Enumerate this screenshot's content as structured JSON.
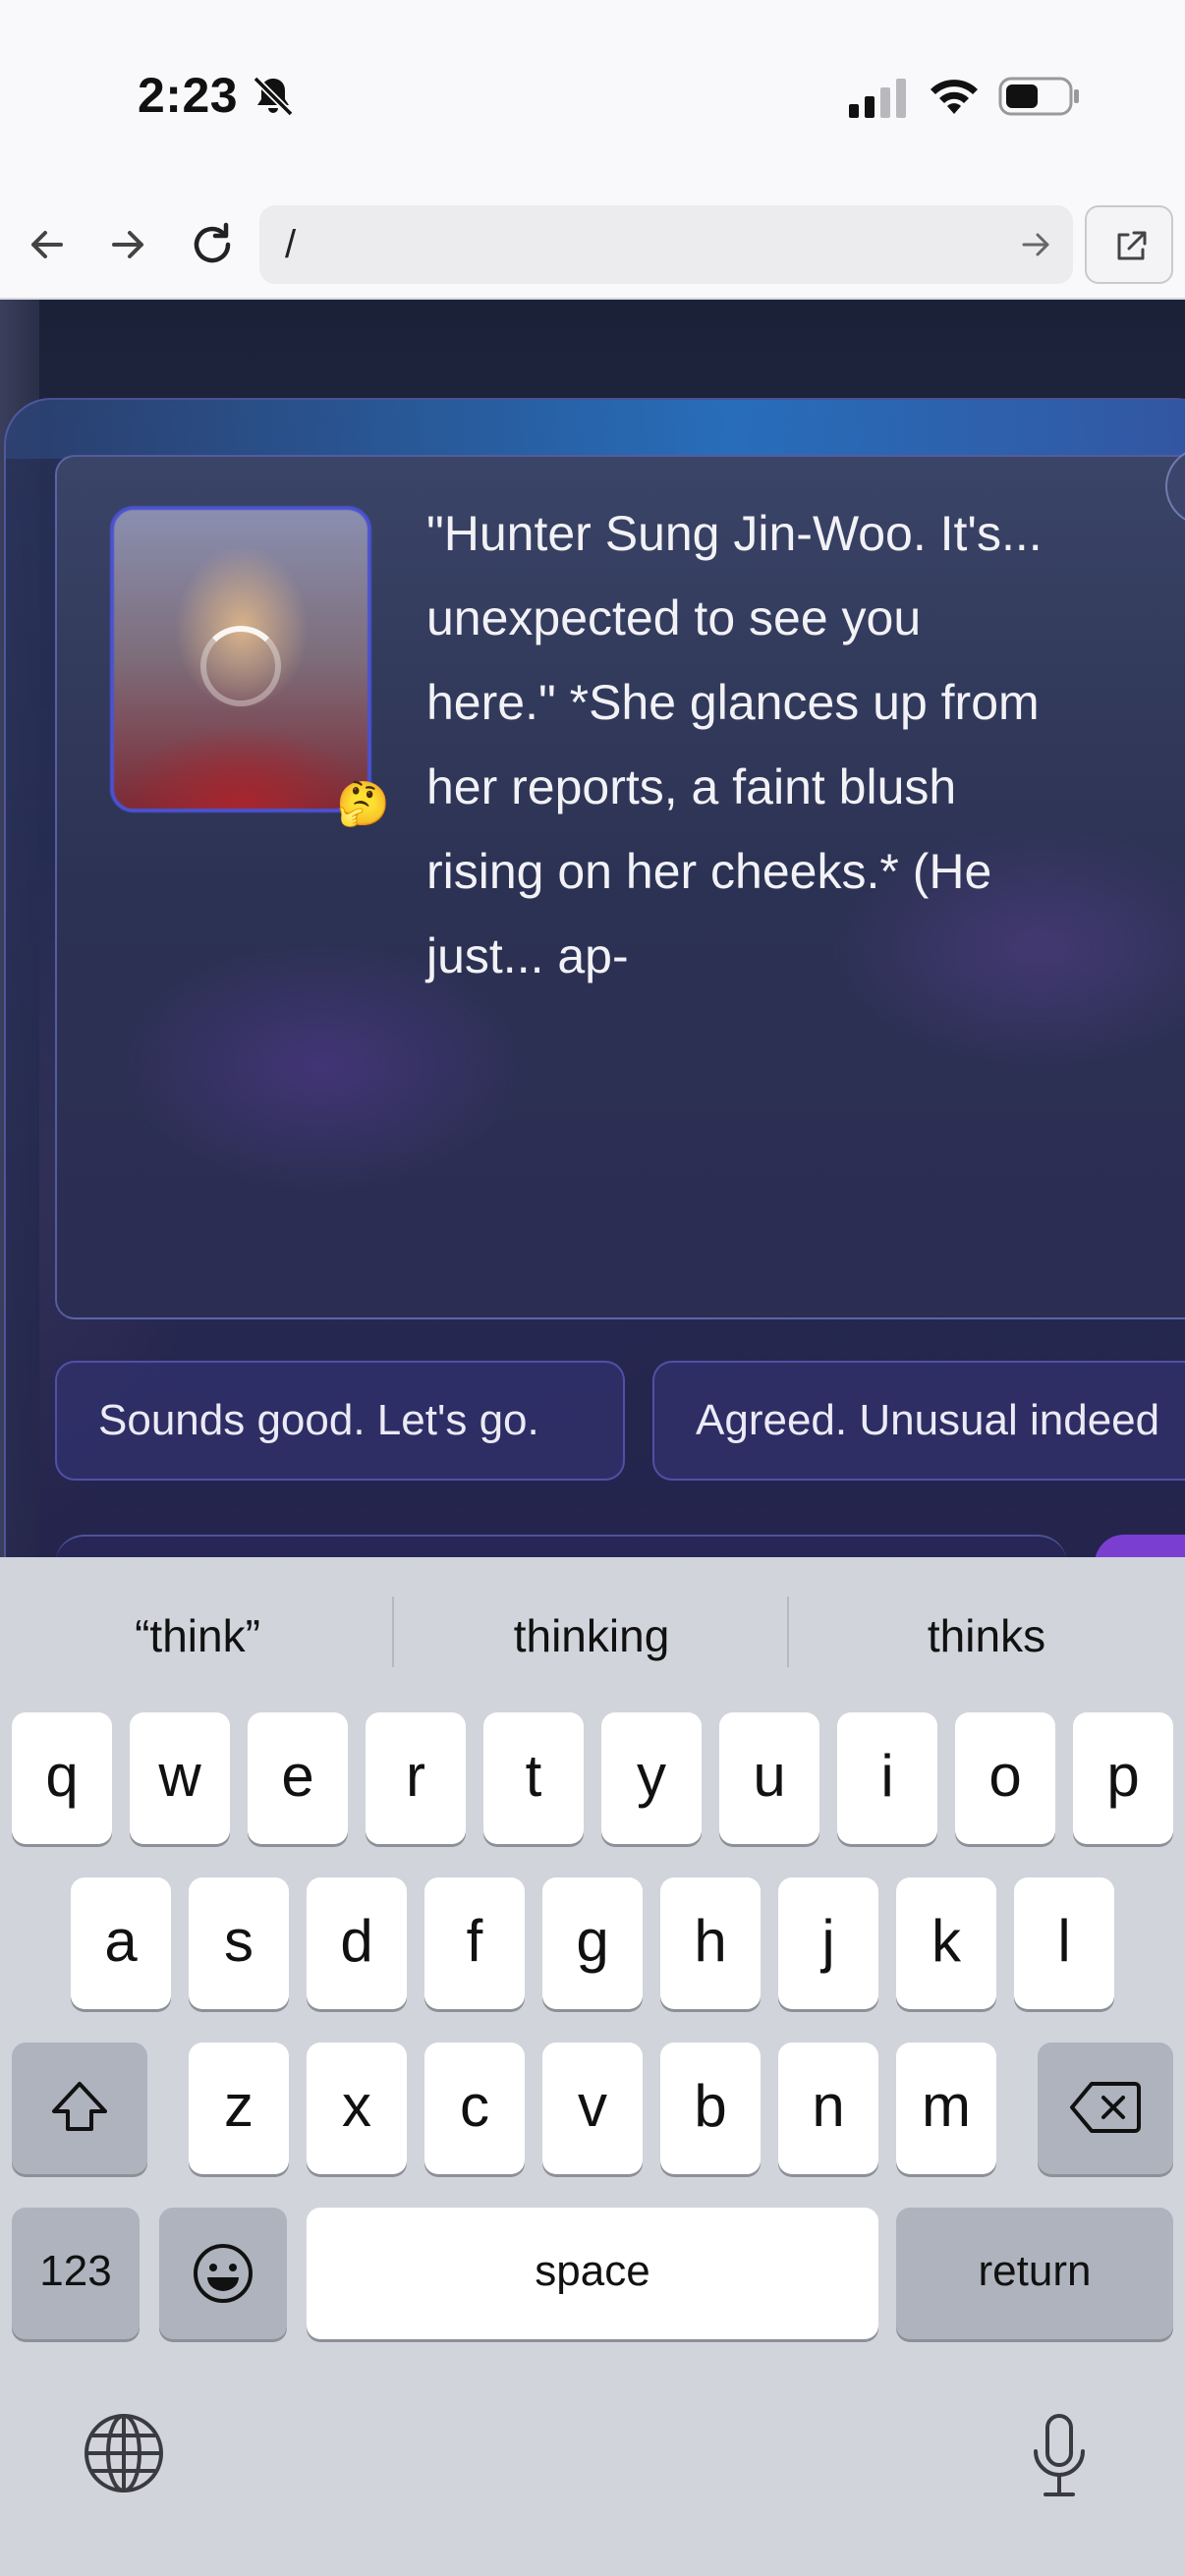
{
  "status_bar": {
    "time": "2:23",
    "icons": [
      "bell-slash-icon",
      "cellular-signal-icon",
      "wifi-icon",
      "battery-icon"
    ]
  },
  "browser": {
    "back_icon": "arrow-left-icon",
    "forward_icon": "arrow-right-icon",
    "reload_icon": "reload-icon",
    "url": "/",
    "go_icon": "arrow-right-icon",
    "open_external_icon": "external-link-icon"
  },
  "chat": {
    "avatar_emoji": "🤔",
    "message": "\"Hunter Sung Jin-Woo. It's... unexpected to see you here.\" *She glances up from her reports, a faint blush rising on her cheeks.* (He just... ap-",
    "suggestions": [
      "Sounds good. Let's go.",
      "Agreed. Unusual indeed"
    ]
  },
  "keyboard": {
    "predictions": [
      "“think”",
      "thinking",
      "thinks"
    ],
    "row1": [
      "q",
      "w",
      "e",
      "r",
      "t",
      "y",
      "u",
      "i",
      "o",
      "p"
    ],
    "row2": [
      "a",
      "s",
      "d",
      "f",
      "g",
      "h",
      "j",
      "k",
      "l"
    ],
    "row3": [
      "z",
      "x",
      "c",
      "v",
      "b",
      "n",
      "m"
    ],
    "numbers_label": "123",
    "space_label": "space",
    "return_label": "return",
    "shift_icon": "shift-icon",
    "delete_icon": "delete-icon",
    "emoji_icon": "emoji-icon",
    "globe_icon": "globe-icon",
    "mic_icon": "microphone-icon"
  },
  "colors": {
    "accent": "#4a52d0",
    "send_button": "#7a3fd0",
    "keyboard_bg": "#d1d4db"
  }
}
